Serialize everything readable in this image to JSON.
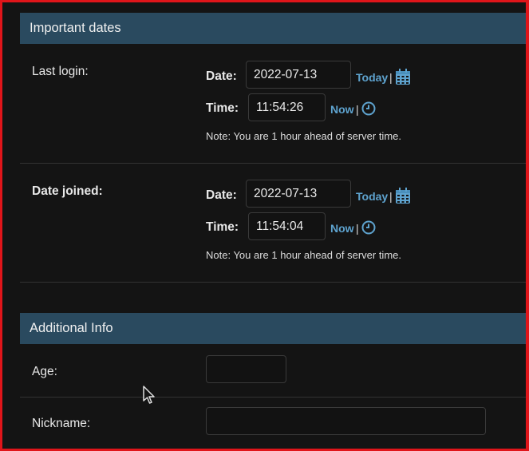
{
  "important_dates": {
    "header": "Important dates",
    "last_login": {
      "label": "Last login:",
      "date_label": "Date:",
      "date_value": "2022-07-13",
      "today_link": "Today",
      "time_label": "Time:",
      "time_value": "11:54:26",
      "now_link": "Now",
      "note": "Note: You are 1 hour ahead of server time."
    },
    "date_joined": {
      "label": "Date joined:",
      "date_label": "Date:",
      "date_value": "2022-07-13",
      "today_link": "Today",
      "time_label": "Time:",
      "time_value": "11:54:04",
      "now_link": "Now",
      "note": "Note: You are 1 hour ahead of server time."
    },
    "separator": "|"
  },
  "additional_info": {
    "header": "Additional Info",
    "age": {
      "label": "Age:",
      "value": ""
    },
    "nickname": {
      "label": "Nickname:",
      "value": ""
    }
  },
  "icons": {
    "calendar": "calendar-icon",
    "clock": "clock-icon"
  },
  "colors": {
    "header_bg": "#2a4a5f",
    "link": "#5ea3cf",
    "frame_border": "#e0151a"
  }
}
